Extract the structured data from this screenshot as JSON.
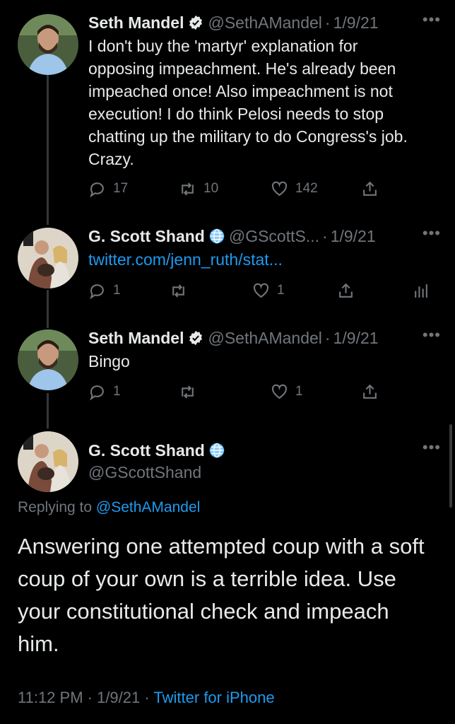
{
  "tweets": [
    {
      "name": "Seth Mandel",
      "handle": "@SethAMandel",
      "date": "1/9/21",
      "text": "I don't buy the 'martyr' explanation for opposing impeachment. He's already been impeached once! Also impeachment is not execution! I do think Pelosi needs to stop chatting up the military to do Congress's job. Crazy.",
      "replies": "17",
      "retweets": "10",
      "likes": "142"
    },
    {
      "name": "G. Scott Shand",
      "handle": "@GScottS...",
      "date": "1/9/21",
      "link": "twitter.com/jenn_ruth/stat...",
      "replies": "1",
      "retweets": "",
      "likes": "1"
    },
    {
      "name": "Seth Mandel",
      "handle": "@SethAMandel",
      "date": "1/9/21",
      "text": "Bingo",
      "replies": "1",
      "retweets": "",
      "likes": "1"
    }
  ],
  "main_tweet": {
    "name": "G. Scott Shand",
    "handle": "@GScottShand",
    "replying_prefix": "Replying to",
    "replying_to": "@SethAMandel",
    "text": "Answering one attempted coup with a soft coup of your own is a terrible idea. Use your constitutional check and impeach him.",
    "timestamp": "11:12 PM · 1/9/21 ·",
    "source": "Twitter for iPhone"
  },
  "separator": "·",
  "more_glyph": "•••",
  "colors": {
    "background": "#000000",
    "text": "#e7e9ea",
    "secondary": "#71767b",
    "accent": "#1d9bf0",
    "verified": "#e7e9ea"
  },
  "icons": [
    "reply-icon",
    "retweet-icon",
    "like-icon",
    "share-icon",
    "analytics-icon",
    "verified-badge-icon",
    "globe-badge-icon",
    "more-icon"
  ]
}
